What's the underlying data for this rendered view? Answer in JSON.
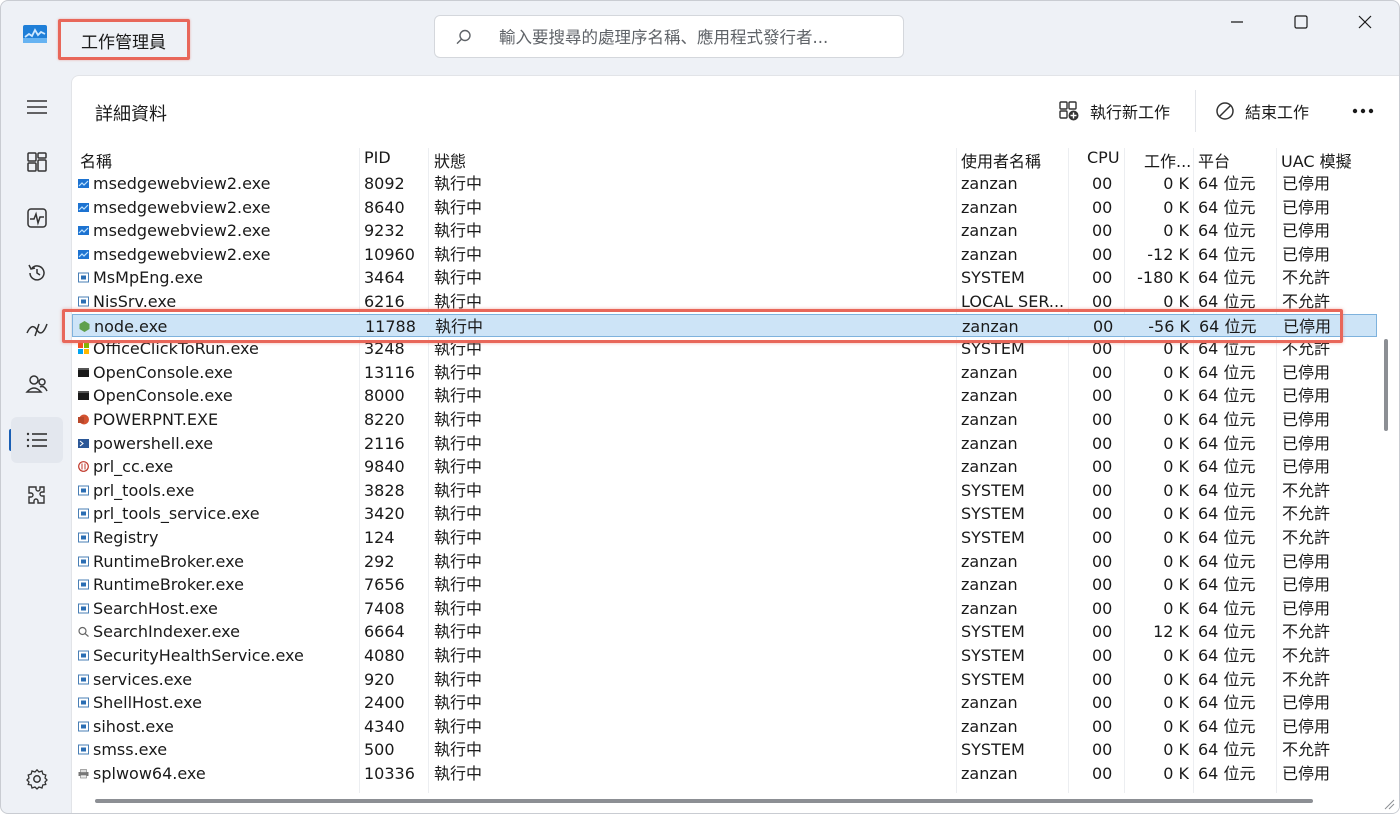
{
  "app": {
    "title": "工作管理員"
  },
  "search": {
    "placeholder": "輸入要搜尋的處理序名稱、應用程式發行者..."
  },
  "page": {
    "title": "詳細資料"
  },
  "toolbar": {
    "run_new_task": "執行新工作",
    "end_task": "結束工作"
  },
  "table": {
    "columns": {
      "name": "名稱",
      "pid": "PID",
      "status": "狀態",
      "user": "使用者名稱",
      "cpu": "CPU",
      "memory": "工作...",
      "platform": "平台",
      "uac": "UAC 模擬"
    },
    "rows": [
      {
        "name": "msedgewebview2.exe",
        "pid": "8092",
        "status": "執行中",
        "user": "zanzan",
        "cpu": "00",
        "mem": "0 K",
        "platform": "64 位元",
        "uac": "已停用",
        "icon": "edge"
      },
      {
        "name": "msedgewebview2.exe",
        "pid": "8640",
        "status": "執行中",
        "user": "zanzan",
        "cpu": "00",
        "mem": "0 K",
        "platform": "64 位元",
        "uac": "已停用",
        "icon": "edge"
      },
      {
        "name": "msedgewebview2.exe",
        "pid": "9232",
        "status": "執行中",
        "user": "zanzan",
        "cpu": "00",
        "mem": "0 K",
        "platform": "64 位元",
        "uac": "已停用",
        "icon": "edge"
      },
      {
        "name": "msedgewebview2.exe",
        "pid": "10960",
        "status": "執行中",
        "user": "zanzan",
        "cpu": "00",
        "mem": "-12 K",
        "platform": "64 位元",
        "uac": "已停用",
        "icon": "edge"
      },
      {
        "name": "MsMpEng.exe",
        "pid": "3464",
        "status": "執行中",
        "user": "SYSTEM",
        "cpu": "00",
        "mem": "-180 K",
        "platform": "64 位元",
        "uac": "不允許",
        "icon": "window"
      },
      {
        "name": "NisSrv.exe",
        "pid": "6216",
        "status": "執行中",
        "user": "LOCAL SER...",
        "cpu": "00",
        "mem": "0 K",
        "platform": "64 位元",
        "uac": "不允許",
        "icon": "window"
      },
      {
        "name": "node.exe",
        "pid": "11788",
        "status": "執行中",
        "user": "zanzan",
        "cpu": "00",
        "mem": "-56 K",
        "platform": "64 位元",
        "uac": "已停用",
        "icon": "node",
        "selected": true
      },
      {
        "name": "OfficeClickToRun.exe",
        "pid": "3248",
        "status": "執行中",
        "user": "SYSTEM",
        "cpu": "00",
        "mem": "0 K",
        "platform": "64 位元",
        "uac": "不允許",
        "icon": "office"
      },
      {
        "name": "OpenConsole.exe",
        "pid": "13116",
        "status": "執行中",
        "user": "zanzan",
        "cpu": "00",
        "mem": "0 K",
        "platform": "64 位元",
        "uac": "已停用",
        "icon": "console"
      },
      {
        "name": "OpenConsole.exe",
        "pid": "8000",
        "status": "執行中",
        "user": "zanzan",
        "cpu": "00",
        "mem": "0 K",
        "platform": "64 位元",
        "uac": "已停用",
        "icon": "console"
      },
      {
        "name": "POWERPNT.EXE",
        "pid": "8220",
        "status": "執行中",
        "user": "zanzan",
        "cpu": "00",
        "mem": "0 K",
        "platform": "64 位元",
        "uac": "已停用",
        "icon": "powerpoint"
      },
      {
        "name": "powershell.exe",
        "pid": "2116",
        "status": "執行中",
        "user": "zanzan",
        "cpu": "00",
        "mem": "0 K",
        "platform": "64 位元",
        "uac": "已停用",
        "icon": "powershell"
      },
      {
        "name": "prl_cc.exe",
        "pid": "9840",
        "status": "執行中",
        "user": "zanzan",
        "cpu": "00",
        "mem": "0 K",
        "platform": "64 位元",
        "uac": "已停用",
        "icon": "parallels"
      },
      {
        "name": "prl_tools.exe",
        "pid": "3828",
        "status": "執行中",
        "user": "SYSTEM",
        "cpu": "00",
        "mem": "0 K",
        "platform": "64 位元",
        "uac": "不允許",
        "icon": "window"
      },
      {
        "name": "prl_tools_service.exe",
        "pid": "3420",
        "status": "執行中",
        "user": "SYSTEM",
        "cpu": "00",
        "mem": "0 K",
        "platform": "64 位元",
        "uac": "不允許",
        "icon": "window"
      },
      {
        "name": "Registry",
        "pid": "124",
        "status": "執行中",
        "user": "SYSTEM",
        "cpu": "00",
        "mem": "0 K",
        "platform": "64 位元",
        "uac": "不允許",
        "icon": "window"
      },
      {
        "name": "RuntimeBroker.exe",
        "pid": "292",
        "status": "執行中",
        "user": "zanzan",
        "cpu": "00",
        "mem": "0 K",
        "platform": "64 位元",
        "uac": "已停用",
        "icon": "window"
      },
      {
        "name": "RuntimeBroker.exe",
        "pid": "7656",
        "status": "執行中",
        "user": "zanzan",
        "cpu": "00",
        "mem": "0 K",
        "platform": "64 位元",
        "uac": "已停用",
        "icon": "window"
      },
      {
        "name": "SearchHost.exe",
        "pid": "7408",
        "status": "執行中",
        "user": "zanzan",
        "cpu": "00",
        "mem": "0 K",
        "platform": "64 位元",
        "uac": "已停用",
        "icon": "window"
      },
      {
        "name": "SearchIndexer.exe",
        "pid": "6664",
        "status": "執行中",
        "user": "SYSTEM",
        "cpu": "00",
        "mem": "12 K",
        "platform": "64 位元",
        "uac": "不允許",
        "icon": "indexer"
      },
      {
        "name": "SecurityHealthService.exe",
        "pid": "4080",
        "status": "執行中",
        "user": "SYSTEM",
        "cpu": "00",
        "mem": "0 K",
        "platform": "64 位元",
        "uac": "不允許",
        "icon": "window"
      },
      {
        "name": "services.exe",
        "pid": "920",
        "status": "執行中",
        "user": "SYSTEM",
        "cpu": "00",
        "mem": "0 K",
        "platform": "64 位元",
        "uac": "不允許",
        "icon": "window"
      },
      {
        "name": "ShellHost.exe",
        "pid": "2400",
        "status": "執行中",
        "user": "zanzan",
        "cpu": "00",
        "mem": "0 K",
        "platform": "64 位元",
        "uac": "已停用",
        "icon": "window"
      },
      {
        "name": "sihost.exe",
        "pid": "4340",
        "status": "執行中",
        "user": "zanzan",
        "cpu": "00",
        "mem": "0 K",
        "platform": "64 位元",
        "uac": "已停用",
        "icon": "window"
      },
      {
        "name": "smss.exe",
        "pid": "500",
        "status": "執行中",
        "user": "SYSTEM",
        "cpu": "00",
        "mem": "0 K",
        "platform": "64 位元",
        "uac": "不允許",
        "icon": "window"
      },
      {
        "name": "splwow64.exe",
        "pid": "10336",
        "status": "執行中",
        "user": "zanzan",
        "cpu": "00",
        "mem": "0 K",
        "platform": "64 位元",
        "uac": "已停用",
        "icon": "printer"
      }
    ]
  },
  "colors": {
    "selected_row_bg": "#cde4f7",
    "highlight_border": "#e8675a",
    "accent": "#1a5fb4"
  },
  "icons": {
    "sidebar": [
      "hamburger-menu-icon",
      "processes-icon",
      "performance-icon",
      "app-history-icon",
      "startup-apps-icon",
      "users-icon",
      "details-icon",
      "services-icon",
      "settings-icon"
    ],
    "toolbar": [
      "run-new-task-icon",
      "end-task-icon",
      "more-options-icon"
    ]
  }
}
